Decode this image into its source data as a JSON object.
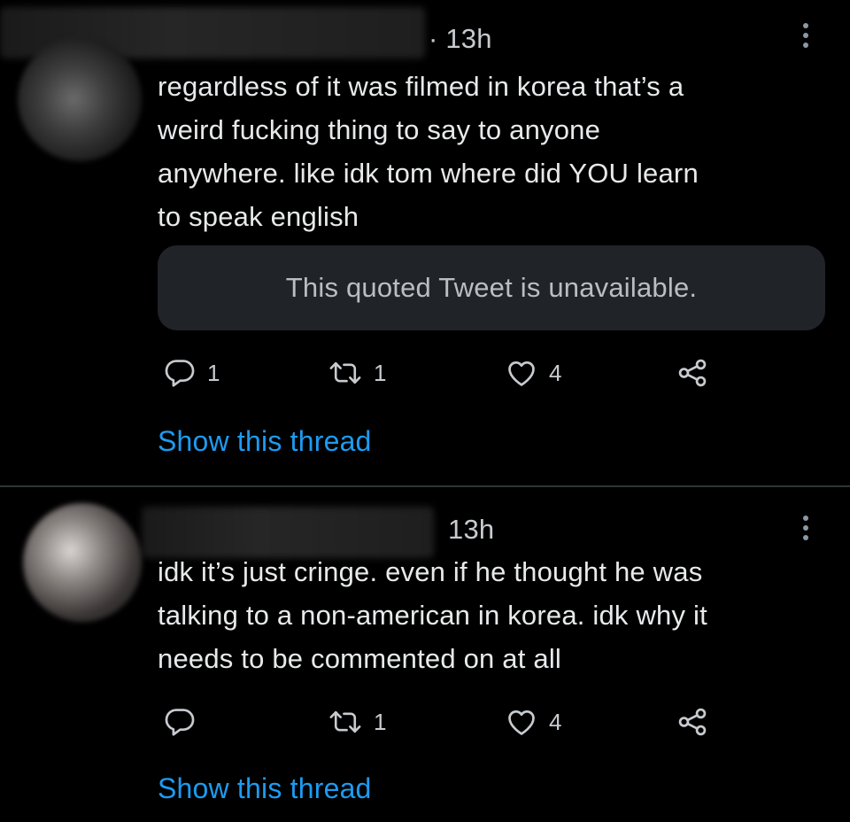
{
  "tweets": [
    {
      "time": "· 13h",
      "text": "regardless of it was filmed in korea that’s a\nweird fucking thing to say to anyone\nanywhere. like idk tom where did YOU learn\nto speak english",
      "quote": "This quoted Tweet is unavailable.",
      "replies": "1",
      "retweets": "1",
      "likes": "4",
      "show_thread": "Show this thread"
    },
    {
      "time": "13h",
      "text": "idk it’s just cringe. even if he thought he was\ntalking to a non-american in korea. idk why it\nneeds to be commented on at all",
      "replies": "",
      "retweets": "1",
      "likes": "4",
      "show_thread": "Show this thread"
    }
  ],
  "icons": {
    "reply": "reply-icon",
    "retweet": "retweet-icon",
    "like": "heart-icon",
    "share": "share-icon",
    "more": "more-icon"
  },
  "colors": {
    "background": "#000000",
    "text": "#e7e9ea",
    "secondary": "#c7cbcf",
    "link": "#1d9bf0",
    "quote_bg": "#202327"
  }
}
